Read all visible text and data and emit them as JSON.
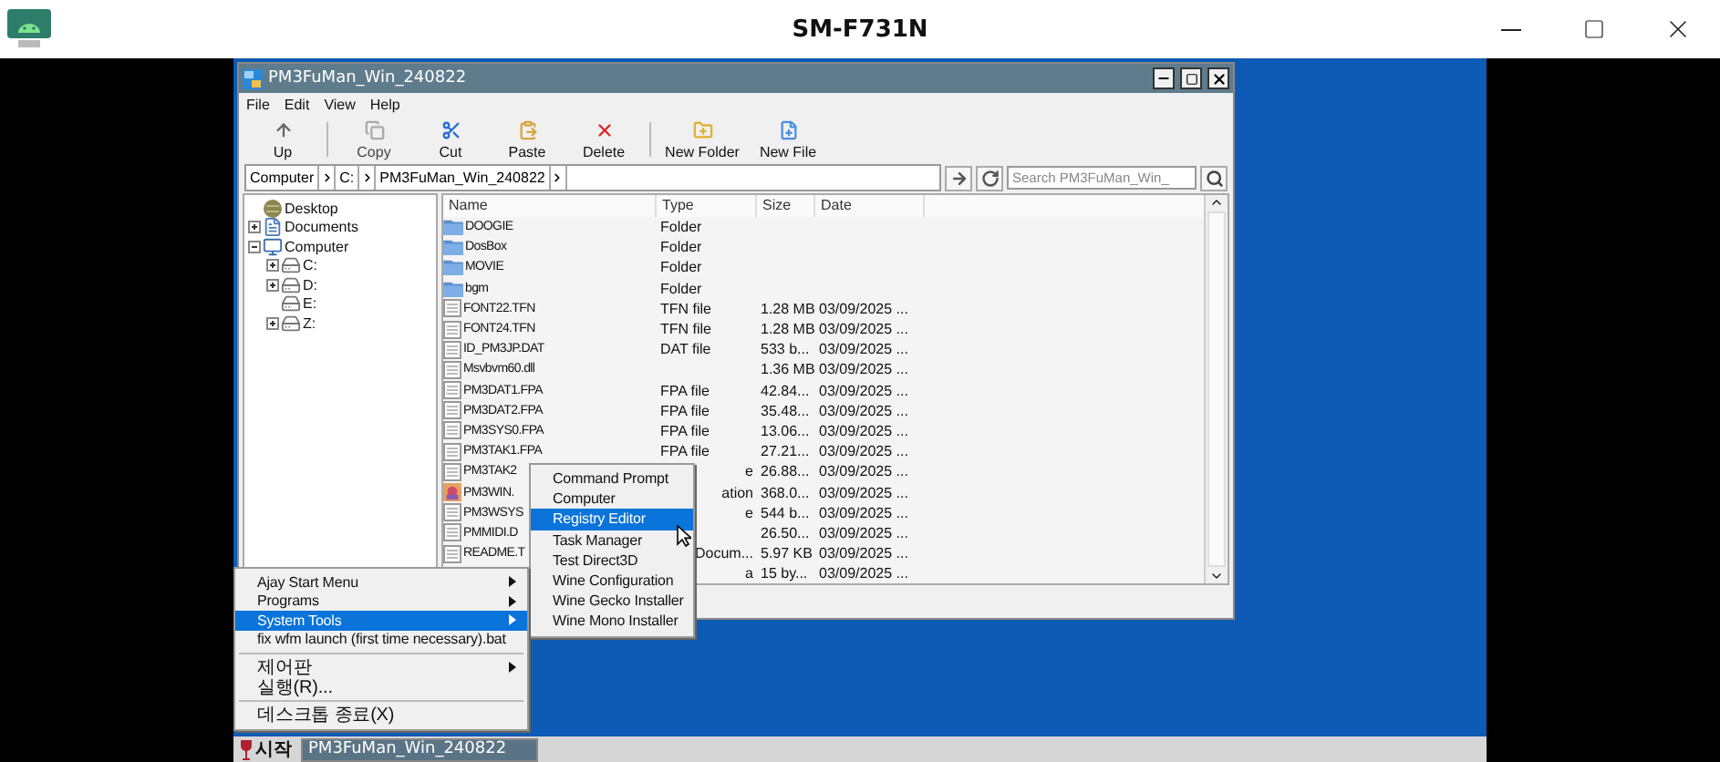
{
  "window": {
    "title": "SM-F731N"
  },
  "explorer": {
    "title": "PM3FuMan_Win_240822",
    "menu": [
      "File",
      "Edit",
      "View",
      "Help"
    ],
    "toolbar": [
      {
        "label": "Up",
        "kind": "up",
        "disabled": false
      },
      {
        "label": "Copy",
        "kind": "copy",
        "disabled": true
      },
      {
        "label": "Cut",
        "kind": "cut",
        "disabled": false
      },
      {
        "label": "Paste",
        "kind": "paste",
        "disabled": false
      },
      {
        "label": "Delete",
        "kind": "delete",
        "disabled": false
      },
      {
        "label": "New Folder",
        "kind": "newfolder",
        "disabled": false
      },
      {
        "label": "New File",
        "kind": "newfile",
        "disabled": false
      }
    ],
    "address": {
      "crumbs": [
        "Computer",
        "C:",
        "PM3FuMan_Win_240822"
      ],
      "search_placeholder": "Search PM3FuMan_Win_"
    },
    "tree": [
      {
        "label": "Desktop",
        "kind": "desktop"
      },
      {
        "label": "Documents",
        "kind": "documents",
        "expanded": false
      },
      {
        "label": "Computer",
        "kind": "computer",
        "expanded": true,
        "children": [
          {
            "label": "C:",
            "kind": "drive",
            "expanded": false
          },
          {
            "label": "D:",
            "kind": "drive",
            "expanded": false
          },
          {
            "label": "E:",
            "kind": "drive"
          },
          {
            "label": "Z:",
            "kind": "drive",
            "expanded": false
          }
        ]
      }
    ],
    "columns": [
      "Name",
      "Type",
      "Size",
      "Date"
    ],
    "rows": [
      {
        "kind": "folder",
        "name": "DOOGIE",
        "type": "Folder"
      },
      {
        "kind": "folder",
        "name": "DosBox",
        "type": "Folder"
      },
      {
        "kind": "folder",
        "name": "MOVIE",
        "type": "Folder"
      },
      {
        "kind": "folder",
        "name": "bgm",
        "type": "Folder"
      },
      {
        "kind": "file",
        "name": "FONT22.TFN",
        "type": "TFN file",
        "size": "1.28 MB",
        "date": "03/09/2025 ..."
      },
      {
        "kind": "file",
        "name": "FONT24.TFN",
        "type": "TFN file",
        "size": "1.28 MB",
        "date": "03/09/2025 ..."
      },
      {
        "kind": "file",
        "name": "ID_PM3JP.DAT",
        "type": "DAT file",
        "size": "533 b...",
        "date": "03/09/2025 ..."
      },
      {
        "kind": "file",
        "name": "Msvbvm60.dll",
        "size": "1.36 MB",
        "date": "03/09/2025 ..."
      },
      {
        "kind": "file",
        "name": "PM3DAT1.FPA",
        "type": "FPA file",
        "size": "42.84...",
        "date": "03/09/2025 ..."
      },
      {
        "kind": "file",
        "name": "PM3DAT2.FPA",
        "type": "FPA file",
        "size": "35.48...",
        "date": "03/09/2025 ..."
      },
      {
        "kind": "file",
        "name": "PM3SYS0.FPA",
        "type": "FPA file",
        "size": "13.06...",
        "date": "03/09/2025 ..."
      },
      {
        "kind": "file",
        "name": "PM3TAK1.FPA",
        "type": "FPA file",
        "size": "27.21...",
        "date": "03/09/2025 ..."
      },
      {
        "kind": "file",
        "name": "PM3TAK2",
        "type": "e",
        "size": "26.88...",
        "date": "03/09/2025 ..."
      },
      {
        "kind": "app",
        "name": "PM3WIN.",
        "type": "ation",
        "size": "368.0...",
        "date": "03/09/2025 ..."
      },
      {
        "kind": "file",
        "name": "PM3WSYS",
        "type": "e",
        "size": "544 b...",
        "date": "03/09/2025 ..."
      },
      {
        "kind": "file",
        "name": "PMMIDI.D",
        "size": "26.50...",
        "date": "03/09/2025 ..."
      },
      {
        "kind": "file",
        "name": "README.T",
        "type": "Docum...",
        "size": "5.97 KB",
        "date": "03/09/2025 ..."
      },
      {
        "type": "a",
        "size": "15 by...",
        "date": "03/09/2025 ..."
      }
    ]
  },
  "start_menu": {
    "items": [
      {
        "label": "Ajay Start Menu",
        "submenu": true,
        "selected": false
      },
      {
        "label": "Programs",
        "submenu": true,
        "selected": false
      },
      {
        "label": "System Tools",
        "submenu": true,
        "selected": true
      },
      {
        "label": "fix wfm launch (first time necessary).bat",
        "submenu": false,
        "selected": false,
        "divider_after": true
      },
      {
        "label": "제어판",
        "submenu": true,
        "selected": false
      },
      {
        "label": "실행(R)...",
        "submenu": false,
        "selected": false,
        "divider_after": true
      },
      {
        "label": "데스크톱 종료(X)",
        "submenu": false,
        "selected": false
      }
    ],
    "submenu": [
      {
        "label": "Command Prompt",
        "selected": false
      },
      {
        "label": "Computer",
        "selected": false
      },
      {
        "label": "Registry Editor",
        "selected": true
      },
      {
        "label": "Task Manager",
        "selected": false
      },
      {
        "label": "Test Direct3D",
        "selected": false
      },
      {
        "label": "Wine Configuration",
        "selected": false
      },
      {
        "label": "Wine Gecko Installer",
        "selected": false
      },
      {
        "label": "Wine Mono Installer",
        "selected": false
      }
    ]
  },
  "taskbar": {
    "start": "시작",
    "tasks": [
      {
        "label": "PM3FuMan_Win_240822",
        "selected": true
      }
    ]
  }
}
